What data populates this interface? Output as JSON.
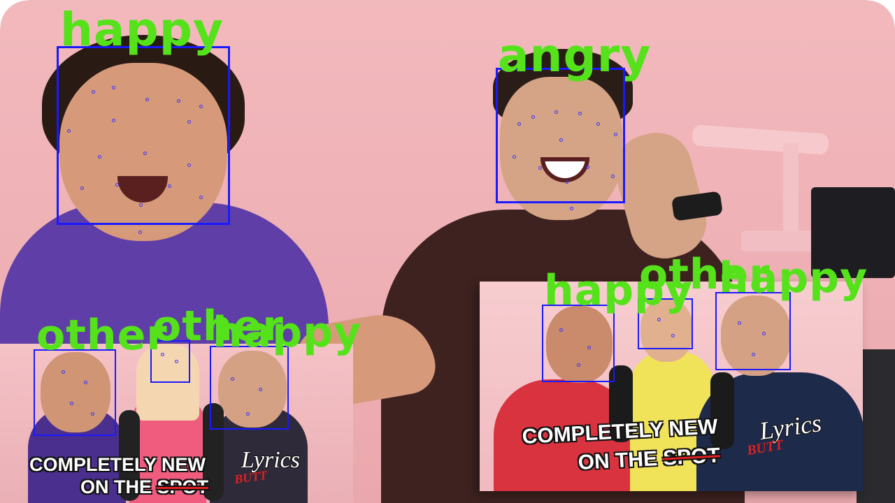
{
  "detections": {
    "main": [
      {
        "id": "face-1",
        "label": "happy"
      },
      {
        "id": "face-2",
        "label": "angry"
      }
    ],
    "thumb_left": [
      {
        "id": "face-3",
        "label": "other"
      },
      {
        "id": "face-4",
        "label": "other"
      },
      {
        "id": "face-5",
        "label": "happy"
      }
    ],
    "thumb_right": [
      {
        "id": "face-6",
        "label": "happy"
      },
      {
        "id": "face-7",
        "label": "other"
      },
      {
        "id": "face-8",
        "label": "happy"
      }
    ]
  },
  "thumbnails": {
    "left": {
      "line1": "COMPLETELY NEW",
      "line2_prefix": "ON THE ",
      "line2_struck": "SPOT",
      "script": "Lyrics",
      "correction": "BUTT"
    },
    "right": {
      "line1": "COMPLETELY NEW",
      "line2_prefix": "ON THE ",
      "line2_struck": "SPOT",
      "script": "Lyrics",
      "correction": "BUTT"
    }
  },
  "colors": {
    "box": "#1a1aff",
    "label": "#55e21b",
    "background": "#eeb0b5"
  }
}
